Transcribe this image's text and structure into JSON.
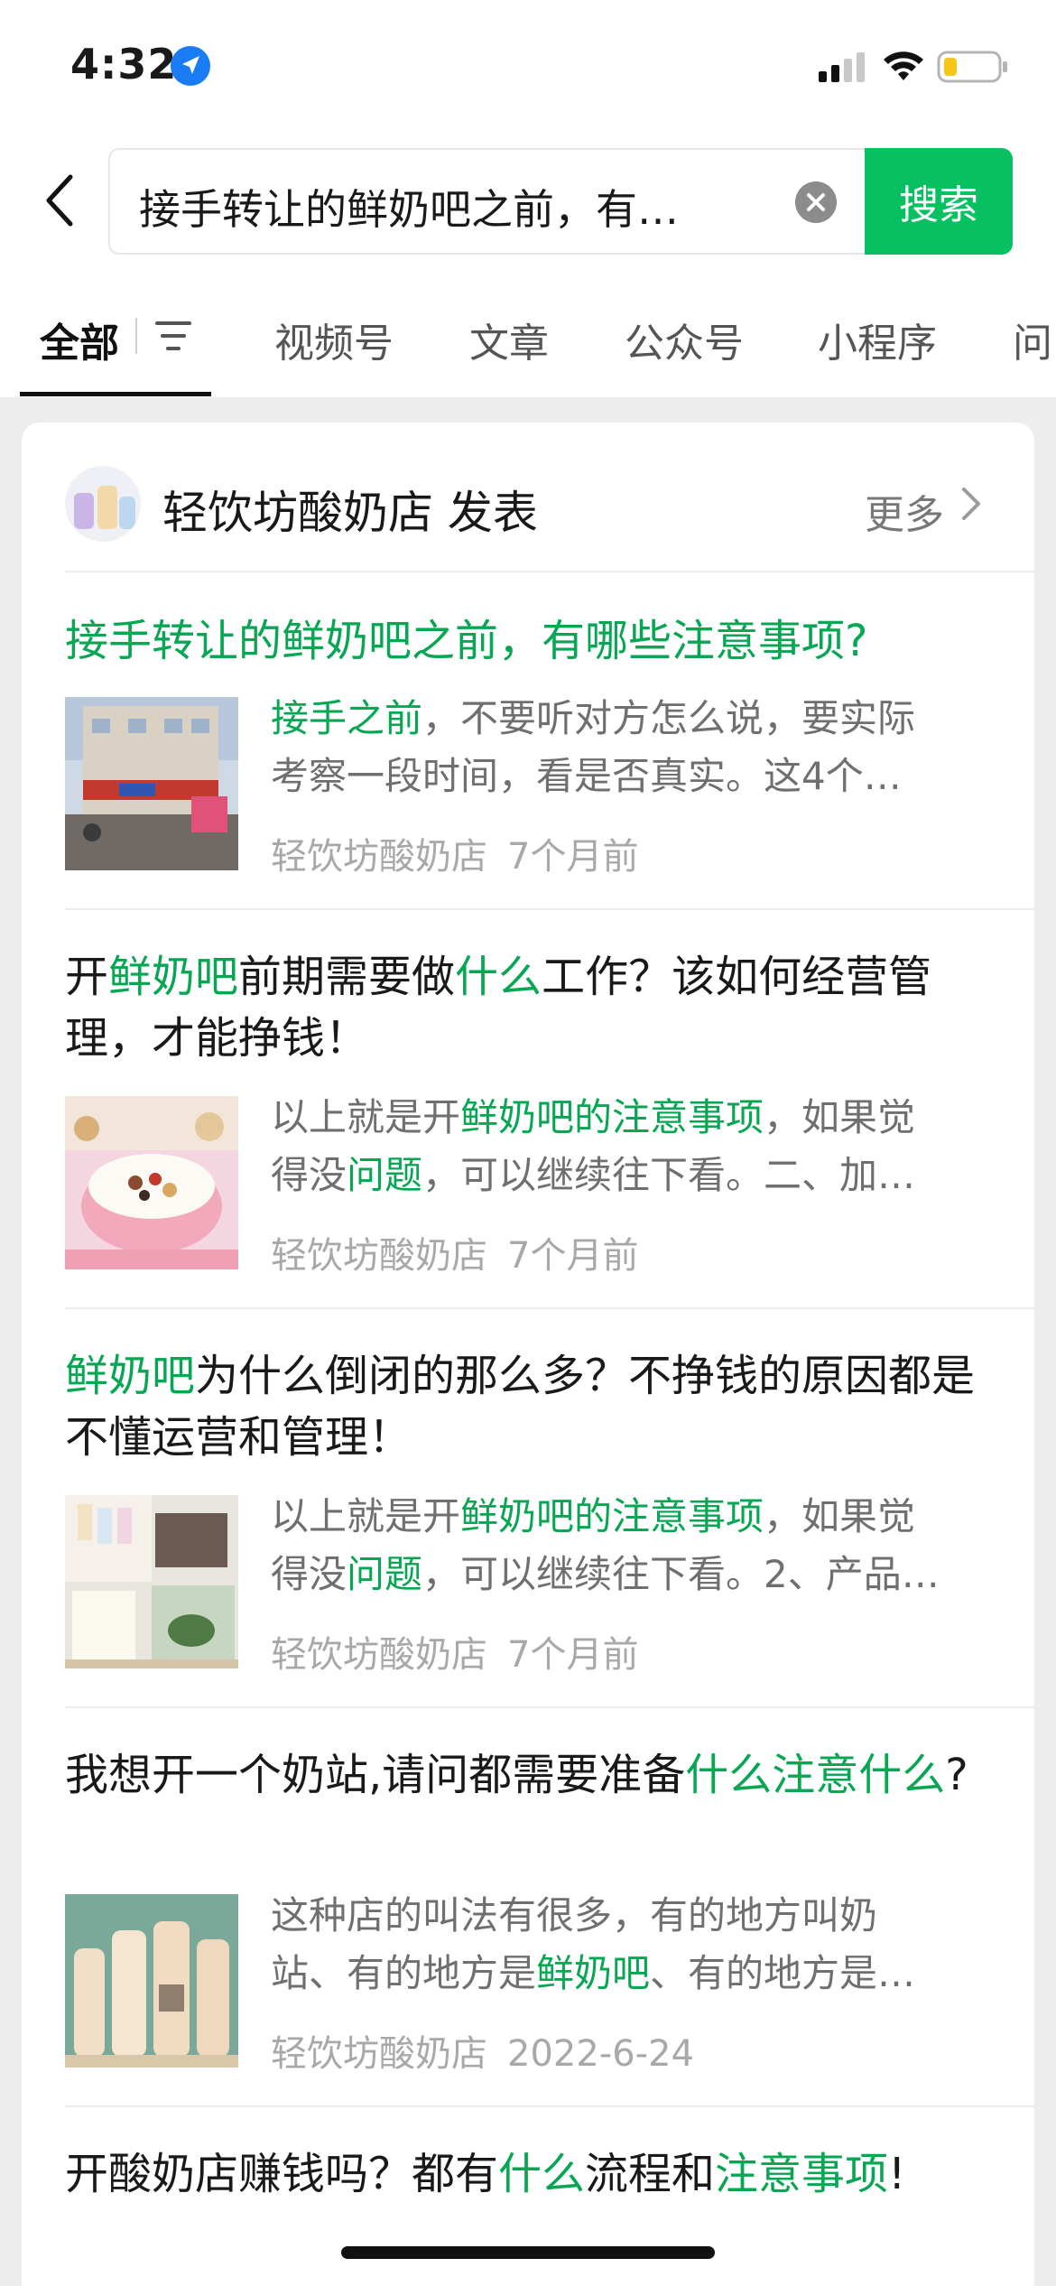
{
  "status_bar": {
    "time": "4:32"
  },
  "search": {
    "query": "接手转让的鲜奶吧之前，有…",
    "button_label": "搜索"
  },
  "tabs": [
    "全部",
    "视频号",
    "文章",
    "公众号",
    "小程序",
    "问"
  ],
  "account": {
    "name": "轻饮坊酸奶店 发表",
    "more": "更多"
  },
  "results": [
    {
      "title_parts": [
        {
          "t": "接手转让的鲜奶吧之前，有哪些注意事项?",
          "h": true
        }
      ],
      "snippet_lines": [
        [
          {
            "t": "接手之前",
            "h": true
          },
          {
            "t": "，不要听对方怎么说，要实际",
            "h": false
          }
        ],
        [
          {
            "t": "考察一段时间，看是否真实。这4个…",
            "h": false
          }
        ]
      ],
      "source": "轻饮坊酸奶店",
      "date": "7个月前"
    },
    {
      "title_parts": [
        {
          "t": "开",
          "h": false
        },
        {
          "t": "鲜奶吧",
          "h": true
        },
        {
          "t": "前期需要做",
          "h": false
        },
        {
          "t": "什么",
          "h": true
        },
        {
          "t": "工作？该如何经营管理，才能挣钱！",
          "h": false
        }
      ],
      "snippet_lines": [
        [
          {
            "t": "以上就是开",
            "h": false
          },
          {
            "t": "鲜奶吧的注意事项",
            "h": true
          },
          {
            "t": "，如果觉",
            "h": false
          }
        ],
        [
          {
            "t": "得没",
            "h": false
          },
          {
            "t": "问题",
            "h": true
          },
          {
            "t": "，可以继续往下看。二、加…",
            "h": false
          }
        ]
      ],
      "source": "轻饮坊酸奶店",
      "date": "7个月前"
    },
    {
      "title_parts": [
        {
          "t": "鲜奶吧",
          "h": true
        },
        {
          "t": "为什么倒闭的那么多？不挣钱的原因都是不懂运营和管理！",
          "h": false
        }
      ],
      "snippet_lines": [
        [
          {
            "t": "以上就是开",
            "h": false
          },
          {
            "t": "鲜奶吧的注意事项",
            "h": true
          },
          {
            "t": "，如果觉",
            "h": false
          }
        ],
        [
          {
            "t": "得没",
            "h": false
          },
          {
            "t": "问题",
            "h": true
          },
          {
            "t": "，可以继续往下看。2、产品…",
            "h": false
          }
        ]
      ],
      "source": "轻饮坊酸奶店",
      "date": "7个月前"
    },
    {
      "title_parts": [
        {
          "t": "我想开一个奶站,请问都需要准备",
          "h": false
        },
        {
          "t": "什么注意什么",
          "h": true
        },
        {
          "t": "?",
          "h": false
        }
      ],
      "snippet_lines": [
        [
          {
            "t": "这种店的叫法有很多，有的地方叫奶",
            "h": false
          }
        ],
        [
          {
            "t": "站、有的地方是",
            "h": false
          },
          {
            "t": "鲜奶吧",
            "h": true
          },
          {
            "t": "、有的地方是…",
            "h": false
          }
        ]
      ],
      "source": "轻饮坊酸奶店",
      "date": "2022-6-24"
    },
    {
      "title_parts": [
        {
          "t": "开酸奶店赚钱吗？都有",
          "h": false
        },
        {
          "t": "什么",
          "h": true
        },
        {
          "t": "流程和",
          "h": false
        },
        {
          "t": "注意事项",
          "h": true
        },
        {
          "t": "!",
          "h": false
        }
      ]
    }
  ]
}
